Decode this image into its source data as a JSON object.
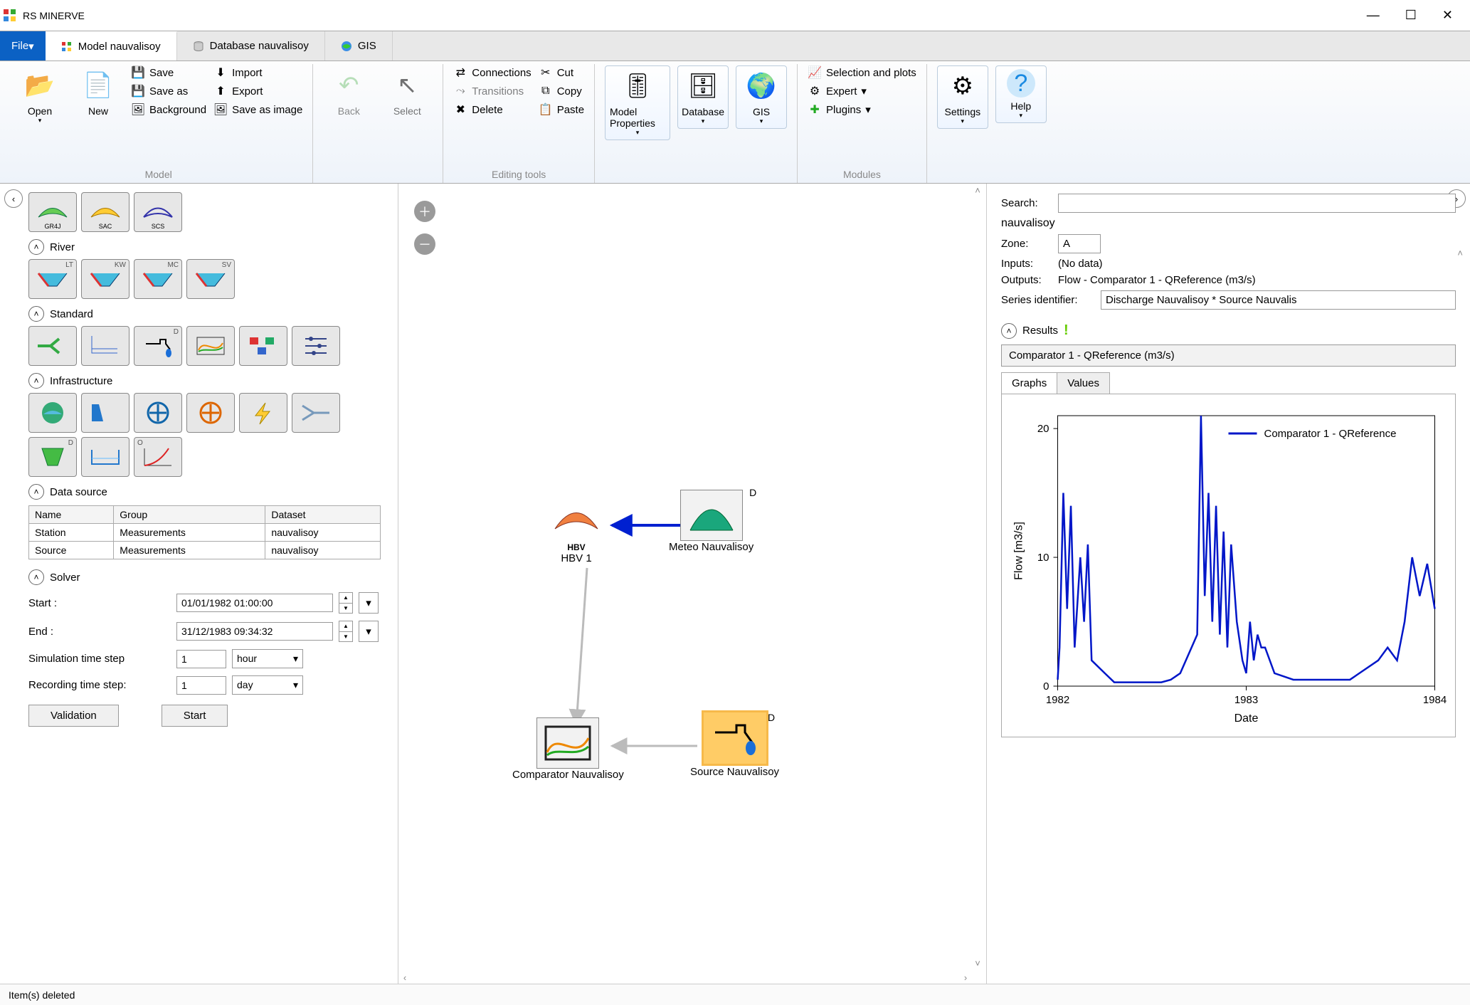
{
  "app": {
    "title": "RS MINERVE"
  },
  "file_menu_label": "File",
  "tabs": {
    "model": "Model nauvalisoy",
    "database": "Database nauvalisoy",
    "gis": "GIS"
  },
  "ribbon": {
    "model": {
      "label": "Model",
      "open": "Open",
      "new": "New",
      "save": "Save",
      "save_as": "Save as",
      "background": "Background",
      "import": "Import",
      "export": "Export",
      "save_image": "Save as image"
    },
    "back": "Back",
    "select": "Select",
    "editing": {
      "label": "Editing tools",
      "connections": "Connections",
      "transitions": "Transitions",
      "delete": "Delete",
      "cut": "Cut",
      "copy": "Copy",
      "paste": "Paste"
    },
    "props": "Model Properties",
    "database": "Database",
    "gis": "GIS",
    "modules": {
      "label": "Modules",
      "selection": "Selection and plots",
      "expert": "Expert",
      "plugins": "Plugins"
    },
    "settings": "Settings",
    "help": "Help"
  },
  "left": {
    "top_swatches": [
      "GR4J",
      "SAC",
      "SCS"
    ],
    "sections": {
      "river": "River",
      "standard": "Standard",
      "infrastructure": "Infrastructure",
      "data_source": "Data source",
      "solver": "Solver"
    },
    "river_corners": [
      "LT",
      "KW",
      "MC",
      "SV"
    ],
    "ds_headers": [
      "Name",
      "Group",
      "Dataset"
    ],
    "ds_rows": [
      {
        "name": "Station",
        "group": "Measurements",
        "dataset": "nauvalisoy"
      },
      {
        "name": "Source",
        "group": "Measurements",
        "dataset": "nauvalisoy"
      }
    ],
    "solver": {
      "start_label": "Start :",
      "start_value": "01/01/1982 01:00:00",
      "end_label": "End :",
      "end_value": "31/12/1983 09:34:32",
      "sim_label": "Simulation time step",
      "sim_value": "1",
      "sim_unit": "hour",
      "rec_label": "Recording time step:",
      "rec_value": "1",
      "rec_unit": "day",
      "validation": "Validation",
      "start_btn": "Start"
    }
  },
  "canvas": {
    "hbv_label": "HBV 1",
    "hbv_caption": "HBV",
    "meteo_label": "Meteo Nauvalisoy",
    "meteo_corner": "D",
    "comparator_label": "Comparator Nauvalisoy",
    "source_label": "Source Nauvalisoy",
    "source_corner": "D"
  },
  "right": {
    "search_label": "Search:",
    "search_value": "",
    "model_name": "nauvalisoy",
    "zone_label": "Zone:",
    "zone_value": "A",
    "inputs_label": "Inputs:",
    "inputs_value": "(No data)",
    "outputs_label": "Outputs:",
    "outputs_value": "Flow - Comparator 1 - QReference (m3/s)",
    "series_label": "Series identifier:",
    "series_value": "Discharge Nauvalisoy * Source Nauvalis",
    "results_label": "Results",
    "result_series": "Comparator 1 - QReference (m3/s)",
    "tab_graphs": "Graphs",
    "tab_values": "Values",
    "legend": "Comparator 1 - QReference",
    "y_label": "Flow [m3/s]",
    "x_label": "Date"
  },
  "status": "Item(s) deleted",
  "chart_data": {
    "type": "line",
    "title": "",
    "xlabel": "Date",
    "ylabel": "Flow [m3/s]",
    "xlim": [
      1982,
      1984
    ],
    "ylim": [
      0,
      21
    ],
    "x_ticks": [
      1982,
      1983,
      1984
    ],
    "y_ticks": [
      0,
      10,
      20
    ],
    "series": [
      {
        "name": "Comparator 1 - QReference",
        "x": [
          1982.0,
          1982.01,
          1982.03,
          1982.05,
          1982.07,
          1982.09,
          1982.12,
          1982.14,
          1982.16,
          1982.18,
          1982.25,
          1982.3,
          1982.4,
          1982.55,
          1982.6,
          1982.65,
          1982.74,
          1982.76,
          1982.78,
          1982.8,
          1982.82,
          1982.84,
          1982.86,
          1982.88,
          1982.9,
          1982.92,
          1982.95,
          1982.98,
          1983.0,
          1983.02,
          1983.04,
          1983.06,
          1983.08,
          1983.1,
          1983.15,
          1983.25,
          1983.4,
          1983.55,
          1983.6,
          1983.7,
          1983.75,
          1983.8,
          1983.84,
          1983.88,
          1983.92,
          1983.96,
          1984.0
        ],
        "values": [
          0.5,
          3,
          15,
          6,
          14,
          3,
          10,
          5,
          11,
          2,
          1,
          0.3,
          0.3,
          0.3,
          0.5,
          1,
          4,
          21,
          7,
          15,
          5,
          14,
          4,
          12,
          3,
          11,
          5,
          2,
          1,
          5,
          2,
          4,
          3,
          3,
          1,
          0.5,
          0.5,
          0.5,
          1,
          2,
          3,
          2,
          5,
          10,
          7,
          9.5,
          6
        ]
      }
    ]
  }
}
